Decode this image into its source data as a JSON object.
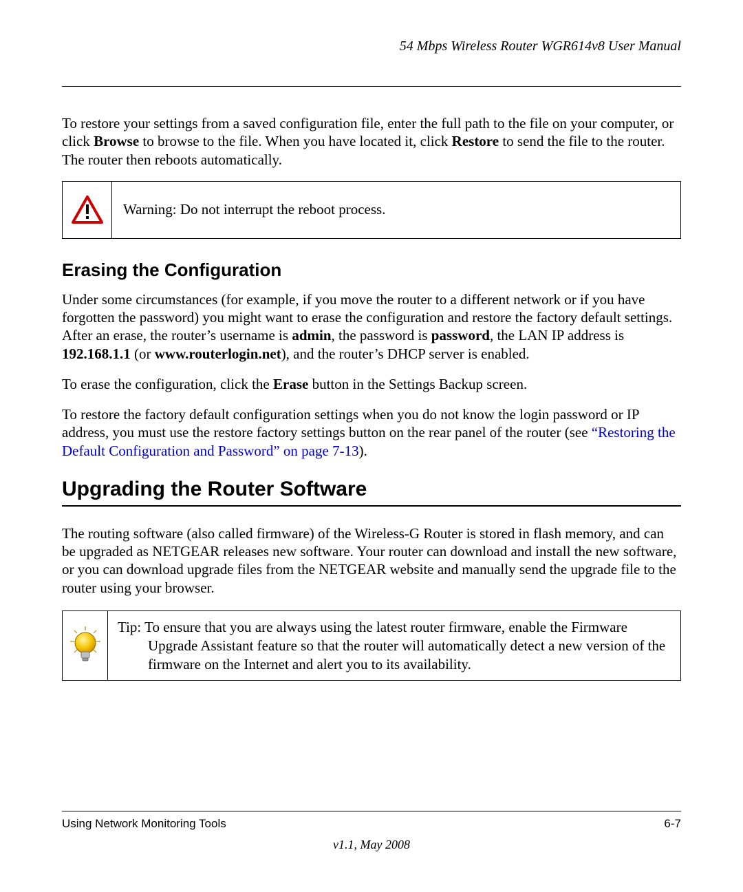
{
  "header": {
    "running_title": "54 Mbps Wireless Router WGR614v8 User Manual"
  },
  "intro": {
    "para1_pre": "To restore your settings from a saved configuration file, enter the full path to the file on your computer, or click ",
    "browse": "Browse",
    "para1_mid": " to browse to the file. When you have located it, click ",
    "restore": "Restore",
    "para1_post": " to send the file to the router. The router then reboots automatically."
  },
  "warning": {
    "label": "Warning:",
    "text": " Do not interrupt the reboot process."
  },
  "erase": {
    "heading": "Erasing the Configuration",
    "p1_a": "Under some circumstances (for example, if you move the router to a different network or if you have forgotten the password) you might want to erase the configuration and restore the factory default settings. After an erase, the router’s username is ",
    "admin": "admin",
    "p1_b": ", the password is ",
    "password": "password",
    "p1_c": ", the LAN IP address is ",
    "ip": "192.168.1.1",
    "p1_d": " (or ",
    "url": "www.routerlogin.net",
    "p1_e": "), and the router’s DHCP server is enabled.",
    "p2_a": "To erase the configuration, click the ",
    "erase_btn": "Erase",
    "p2_b": " button in the Settings Backup screen.",
    "p3_a": "To restore the factory default configuration settings when you do not know the login password or IP address, you must use the restore factory settings button on the rear panel of the router (see ",
    "link": "“Restoring the Default Configuration and Password” on page 7-13",
    "p3_b": ")."
  },
  "upgrade": {
    "heading": "Upgrading the Router Software",
    "p1": "The routing software (also called firmware) of the Wireless-G Router is stored in flash memory, and can be upgraded as NETGEAR releases new software. Your router can download and install the new software, or you can download upgrade files from the NETGEAR website and manually send the upgrade file to the router using your browser."
  },
  "tip": {
    "label": "Tip:",
    "text": " To ensure that you are always using the latest router firmware, enable the Firmware Upgrade Assistant feature so that the router will automatically detect a new version of the firmware on the Internet and alert you to its availability."
  },
  "footer": {
    "section": "Using Network Monitoring Tools",
    "page": "6-7",
    "version": "v1.1, May 2008"
  }
}
